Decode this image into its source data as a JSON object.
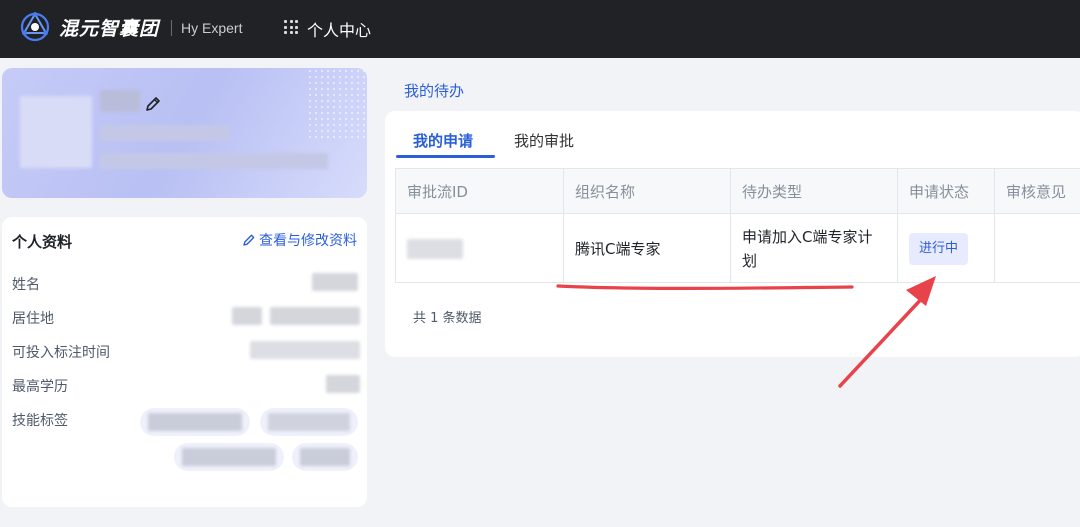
{
  "header": {
    "brand": "混元智囊团",
    "subtitle": "Hy Expert",
    "nav_title": "个人中心"
  },
  "profile_info": {
    "title": "个人资料",
    "edit_link": "查看与修改资料",
    "fields": [
      "姓名",
      "居住地",
      "可投入标注时间",
      "最高学历",
      "技能标签"
    ]
  },
  "todo": {
    "section_title": "我的待办",
    "tabs": [
      "我的申请",
      "我的审批"
    ],
    "active_tab": "我的申请",
    "columns": [
      "审批流ID",
      "组织名称",
      "待办类型",
      "申请状态",
      "审核意见"
    ],
    "rows": [
      {
        "org": "腾讯C端专家",
        "type": "申请加入C端专家计划",
        "status": "进行中",
        "comment": ""
      }
    ],
    "total": "共 1 条数据"
  },
  "colors": {
    "accent": "#2b5fd9",
    "topbar": "#202226",
    "annotation": "#e8434b"
  }
}
